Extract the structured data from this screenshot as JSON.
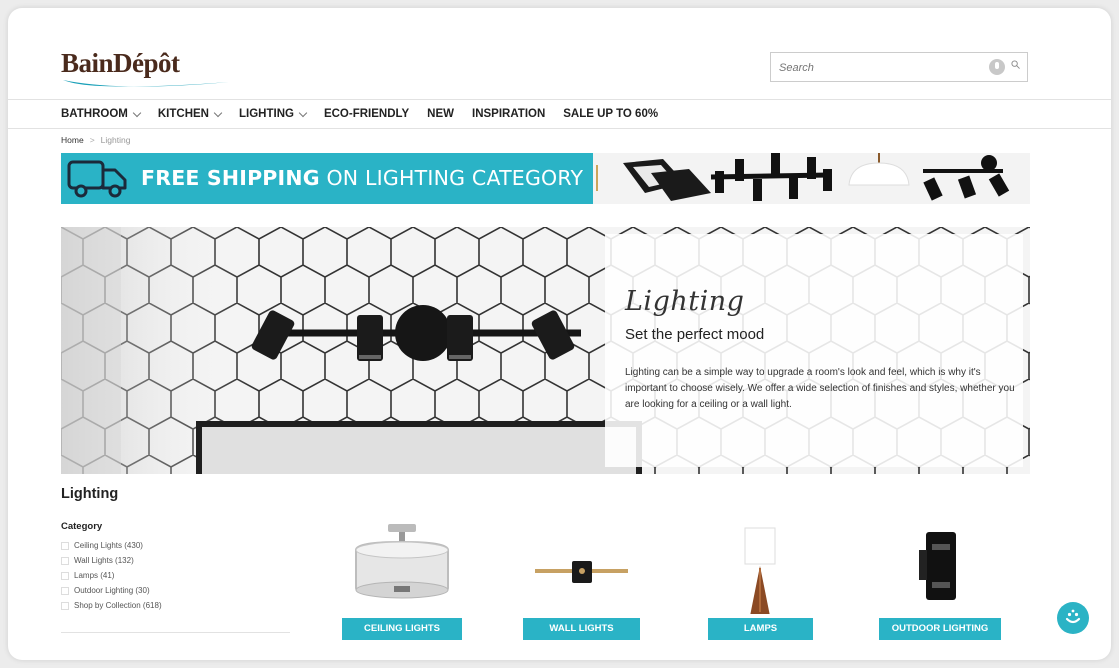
{
  "brand": {
    "name": "BainDépôt"
  },
  "search": {
    "placeholder": "Search"
  },
  "nav": {
    "items": [
      {
        "label": "BATHROOM",
        "has_menu": true
      },
      {
        "label": "KITCHEN",
        "has_menu": true
      },
      {
        "label": "LIGHTING",
        "has_menu": true
      },
      {
        "label": "ECO-FRIENDLY",
        "has_menu": false
      },
      {
        "label": "NEW",
        "has_menu": false
      },
      {
        "label": "INSPIRATION",
        "has_menu": false
      },
      {
        "label": "SALE UP TO 60%",
        "has_menu": false
      }
    ]
  },
  "breadcrumb": {
    "home": "Home",
    "separator": ">",
    "current": "Lighting"
  },
  "promo": {
    "bold": "FREE SHIPPING",
    "rest": " ON LIGHTING CATEGORY"
  },
  "hero": {
    "script_title": "Lighting",
    "subtitle": "Set the perfect mood",
    "description": "Lighting can be a simple way to upgrade a room's look and feel, which is why it's important to choose wisely. We offer a wide selection of finishes and styles, whether you are looking for a ceiling or a wall light."
  },
  "page_title": "Lighting",
  "filters": {
    "title": "Category",
    "items": [
      {
        "label": "Ceiling Lights (430)"
      },
      {
        "label": "Wall Lights (132)"
      },
      {
        "label": "Lamps (41)"
      },
      {
        "label": "Outdoor Lighting (30)"
      },
      {
        "label": "Shop by Collection (618)"
      }
    ]
  },
  "categories": [
    {
      "label": "CEILING LIGHTS",
      "icon": "ceiling-light-icon"
    },
    {
      "label": "WALL LIGHTS",
      "icon": "wall-light-icon"
    },
    {
      "label": "LAMPS",
      "icon": "table-lamp-icon"
    },
    {
      "label": "OUTDOOR LIGHTING",
      "icon": "outdoor-light-icon"
    }
  ],
  "colors": {
    "accent": "#2ab3c6",
    "brand_brown": "#4a2a1c",
    "brand_blue": "#1aa0b8"
  }
}
